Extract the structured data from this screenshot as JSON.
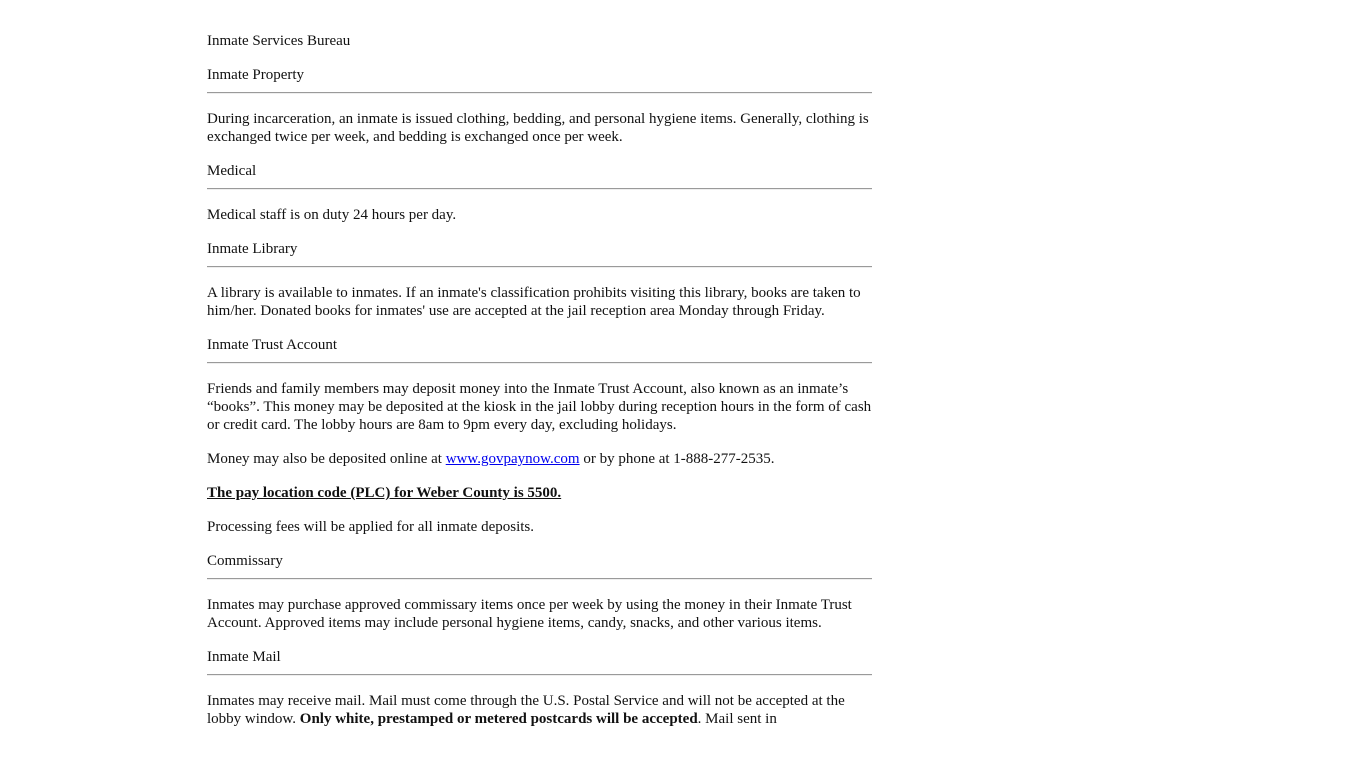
{
  "bureau_title": "Inmate Services Bureau",
  "sections": {
    "property": {
      "heading": "Inmate Property",
      "body": "During incarceration, an inmate is issued clothing, bedding, and personal hygiene items. Generally, clothing is exchanged twice per week, and bedding is exchanged once per week."
    },
    "medical": {
      "heading": "Medical",
      "body": "Medical staff is on duty 24 hours per day."
    },
    "library": {
      "heading": "Inmate Library",
      "body": "A library is available to inmates. If an inmate's classification prohibits visiting this library, books are taken to him/her. Donated books for inmates' use are accepted at the jail reception area Monday through Friday."
    },
    "trust": {
      "heading": "Inmate Trust Account",
      "body": "Friends and family members may deposit money into the Inmate Trust Account, also known as an inmate’s “books”. This money may be deposited at the kiosk in the jail lobby during reception hours in the form of cash or credit card. The lobby hours are 8am to 9pm every day, excluding holidays.",
      "online_prefix": "Money may also be deposited online at ",
      "online_link": "www.govpaynow.com",
      "online_suffix": " or by phone at 1-888-277-2535.",
      "plc_note": "The pay location code (PLC) for Weber County is 5500.",
      "fees_note": "Processing fees will be applied for all inmate deposits."
    },
    "commissary": {
      "heading": "Commissary",
      "body": "Inmates may purchase approved commissary items once per week by using the money in their Inmate Trust Account. Approved items may include personal hygiene items, candy, snacks, and other various items."
    },
    "mail": {
      "heading": "Inmate Mail",
      "body_start": "Inmates may receive mail.  Mail must come through the U.S. Postal Service and will not be accepted at the lobby window.  ",
      "body_bold": "Only white, prestamped or metered postcards will be accepted",
      "body_end": ".  Mail sent in"
    }
  }
}
